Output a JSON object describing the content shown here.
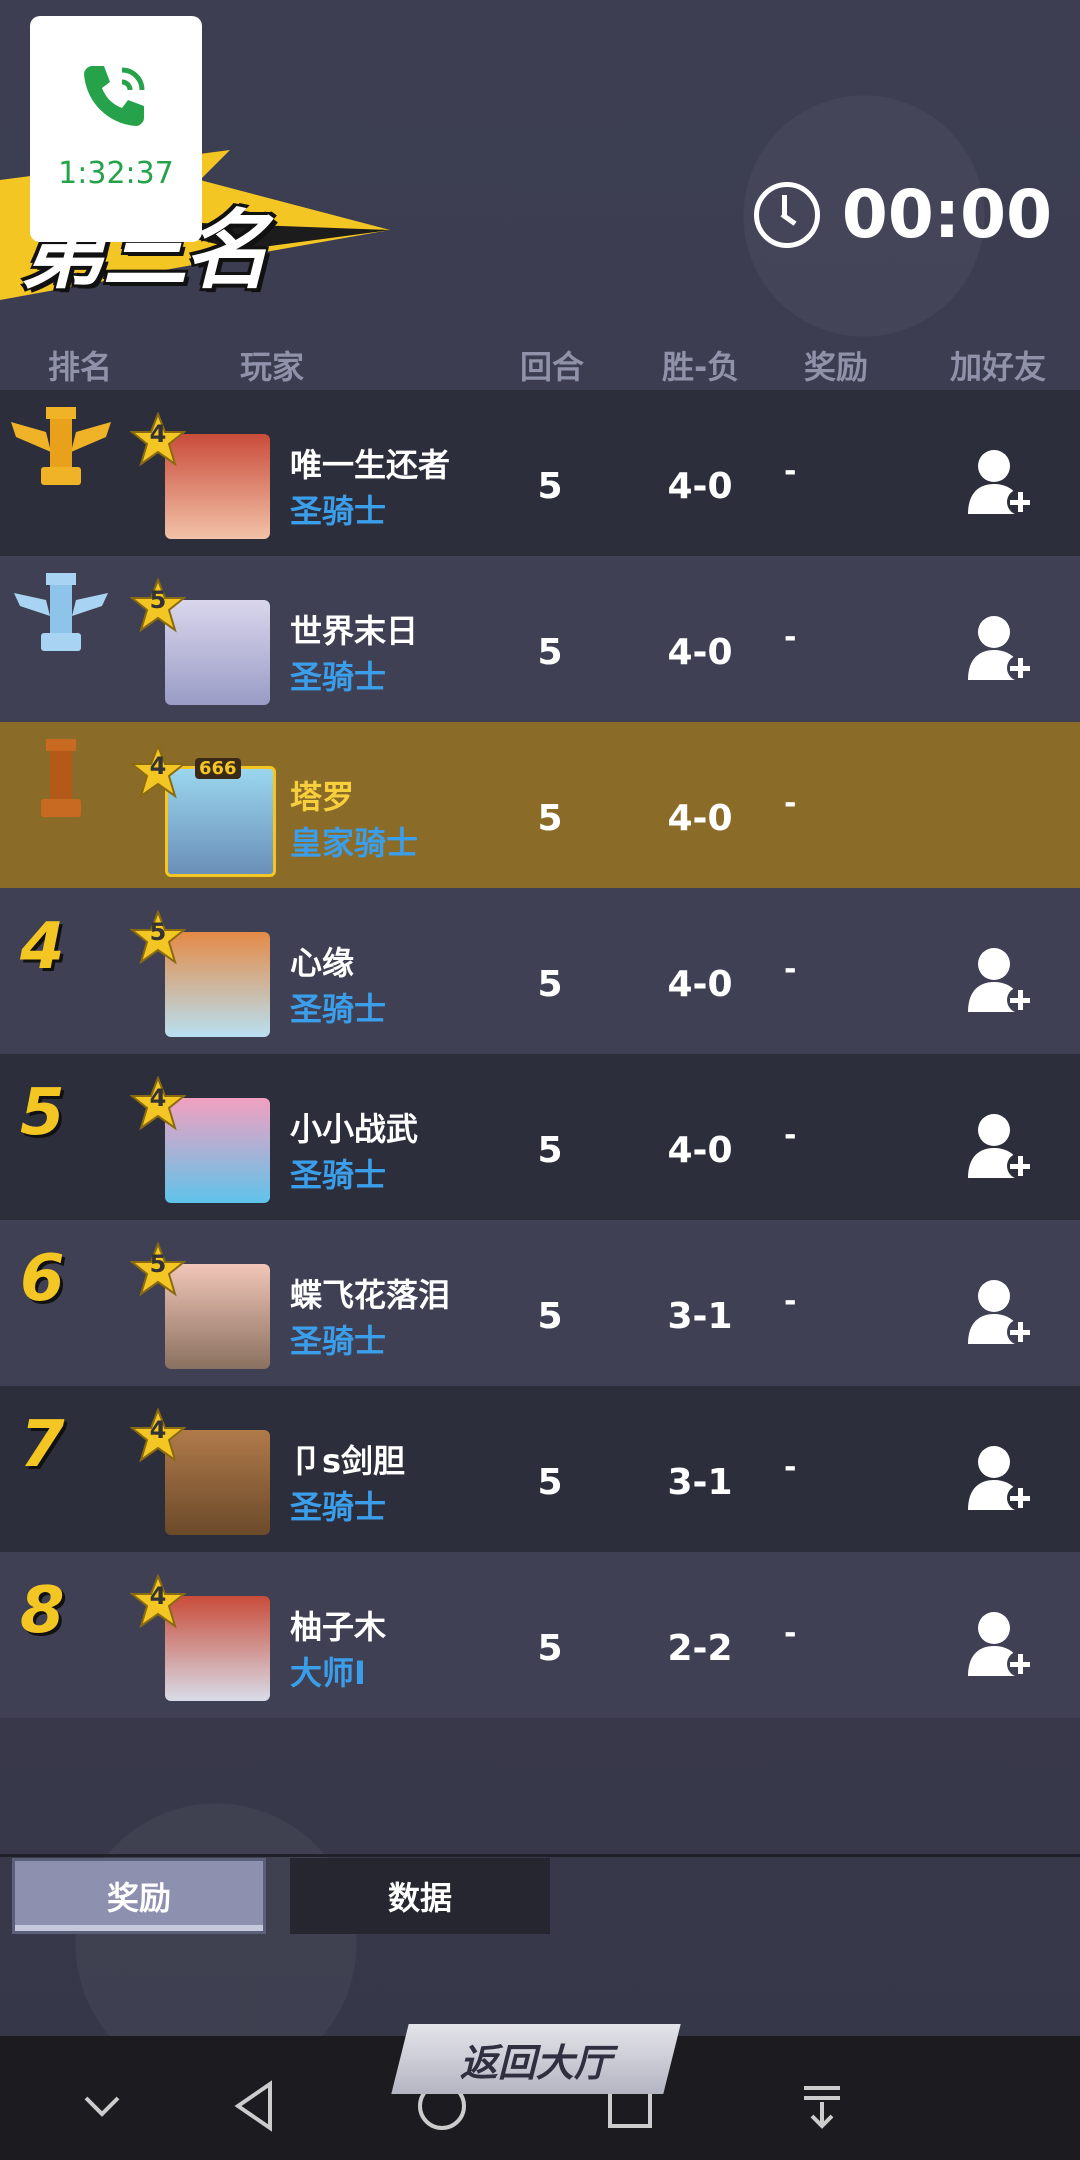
{
  "call": {
    "duration": "1:32:37"
  },
  "banner": {
    "title": "第三名"
  },
  "timer": {
    "value": "00:00"
  },
  "headers": {
    "rank": "排名",
    "player": "玩家",
    "rounds": "回合",
    "record": "胜-负",
    "reward": "奖励",
    "add_friend": "加好友"
  },
  "rows": [
    {
      "rank": "1",
      "level": "4",
      "name": "唯一生还者",
      "title": "圣骑士",
      "rounds": "5",
      "record": "4-0",
      "reward": "-",
      "can_add": true
    },
    {
      "rank": "2",
      "level": "5",
      "name": "世界末日",
      "title": "圣骑士",
      "rounds": "5",
      "record": "4-0",
      "reward": "-",
      "can_add": true
    },
    {
      "rank": "3",
      "level": "4",
      "badge": "666",
      "name": "塔罗",
      "title": "皇家骑士",
      "rounds": "5",
      "record": "4-0",
      "reward": "-",
      "can_add": false
    },
    {
      "rank": "4",
      "level": "5",
      "name": "心缘",
      "title": "圣骑士",
      "rounds": "5",
      "record": "4-0",
      "reward": "-",
      "can_add": true
    },
    {
      "rank": "5",
      "level": "4",
      "name": "小小战武",
      "title": "圣骑士",
      "rounds": "5",
      "record": "4-0",
      "reward": "-",
      "can_add": true
    },
    {
      "rank": "6",
      "level": "5",
      "name": "蝶飞花落泪",
      "title": "圣骑士",
      "rounds": "5",
      "record": "3-1",
      "reward": "-",
      "can_add": true
    },
    {
      "rank": "7",
      "level": "4",
      "name": "卩s剑胆",
      "title": "圣骑士",
      "rounds": "5",
      "record": "3-1",
      "reward": "-",
      "can_add": true
    },
    {
      "rank": "8",
      "level": "4",
      "name": "柚子木",
      "title": "大师I",
      "rounds": "5",
      "record": "2-2",
      "reward": "-",
      "can_add": true
    }
  ],
  "tabs": {
    "rewards": "奖励",
    "data": "数据"
  },
  "return_button": "返回大厅",
  "colors": {
    "gold_trophy": "#f0b327",
    "silver_trophy": "#a9d3f2",
    "bronze_trophy": "#c86a22",
    "highlight_row": "#8a6b27",
    "title_blue": "#3b9eea"
  }
}
